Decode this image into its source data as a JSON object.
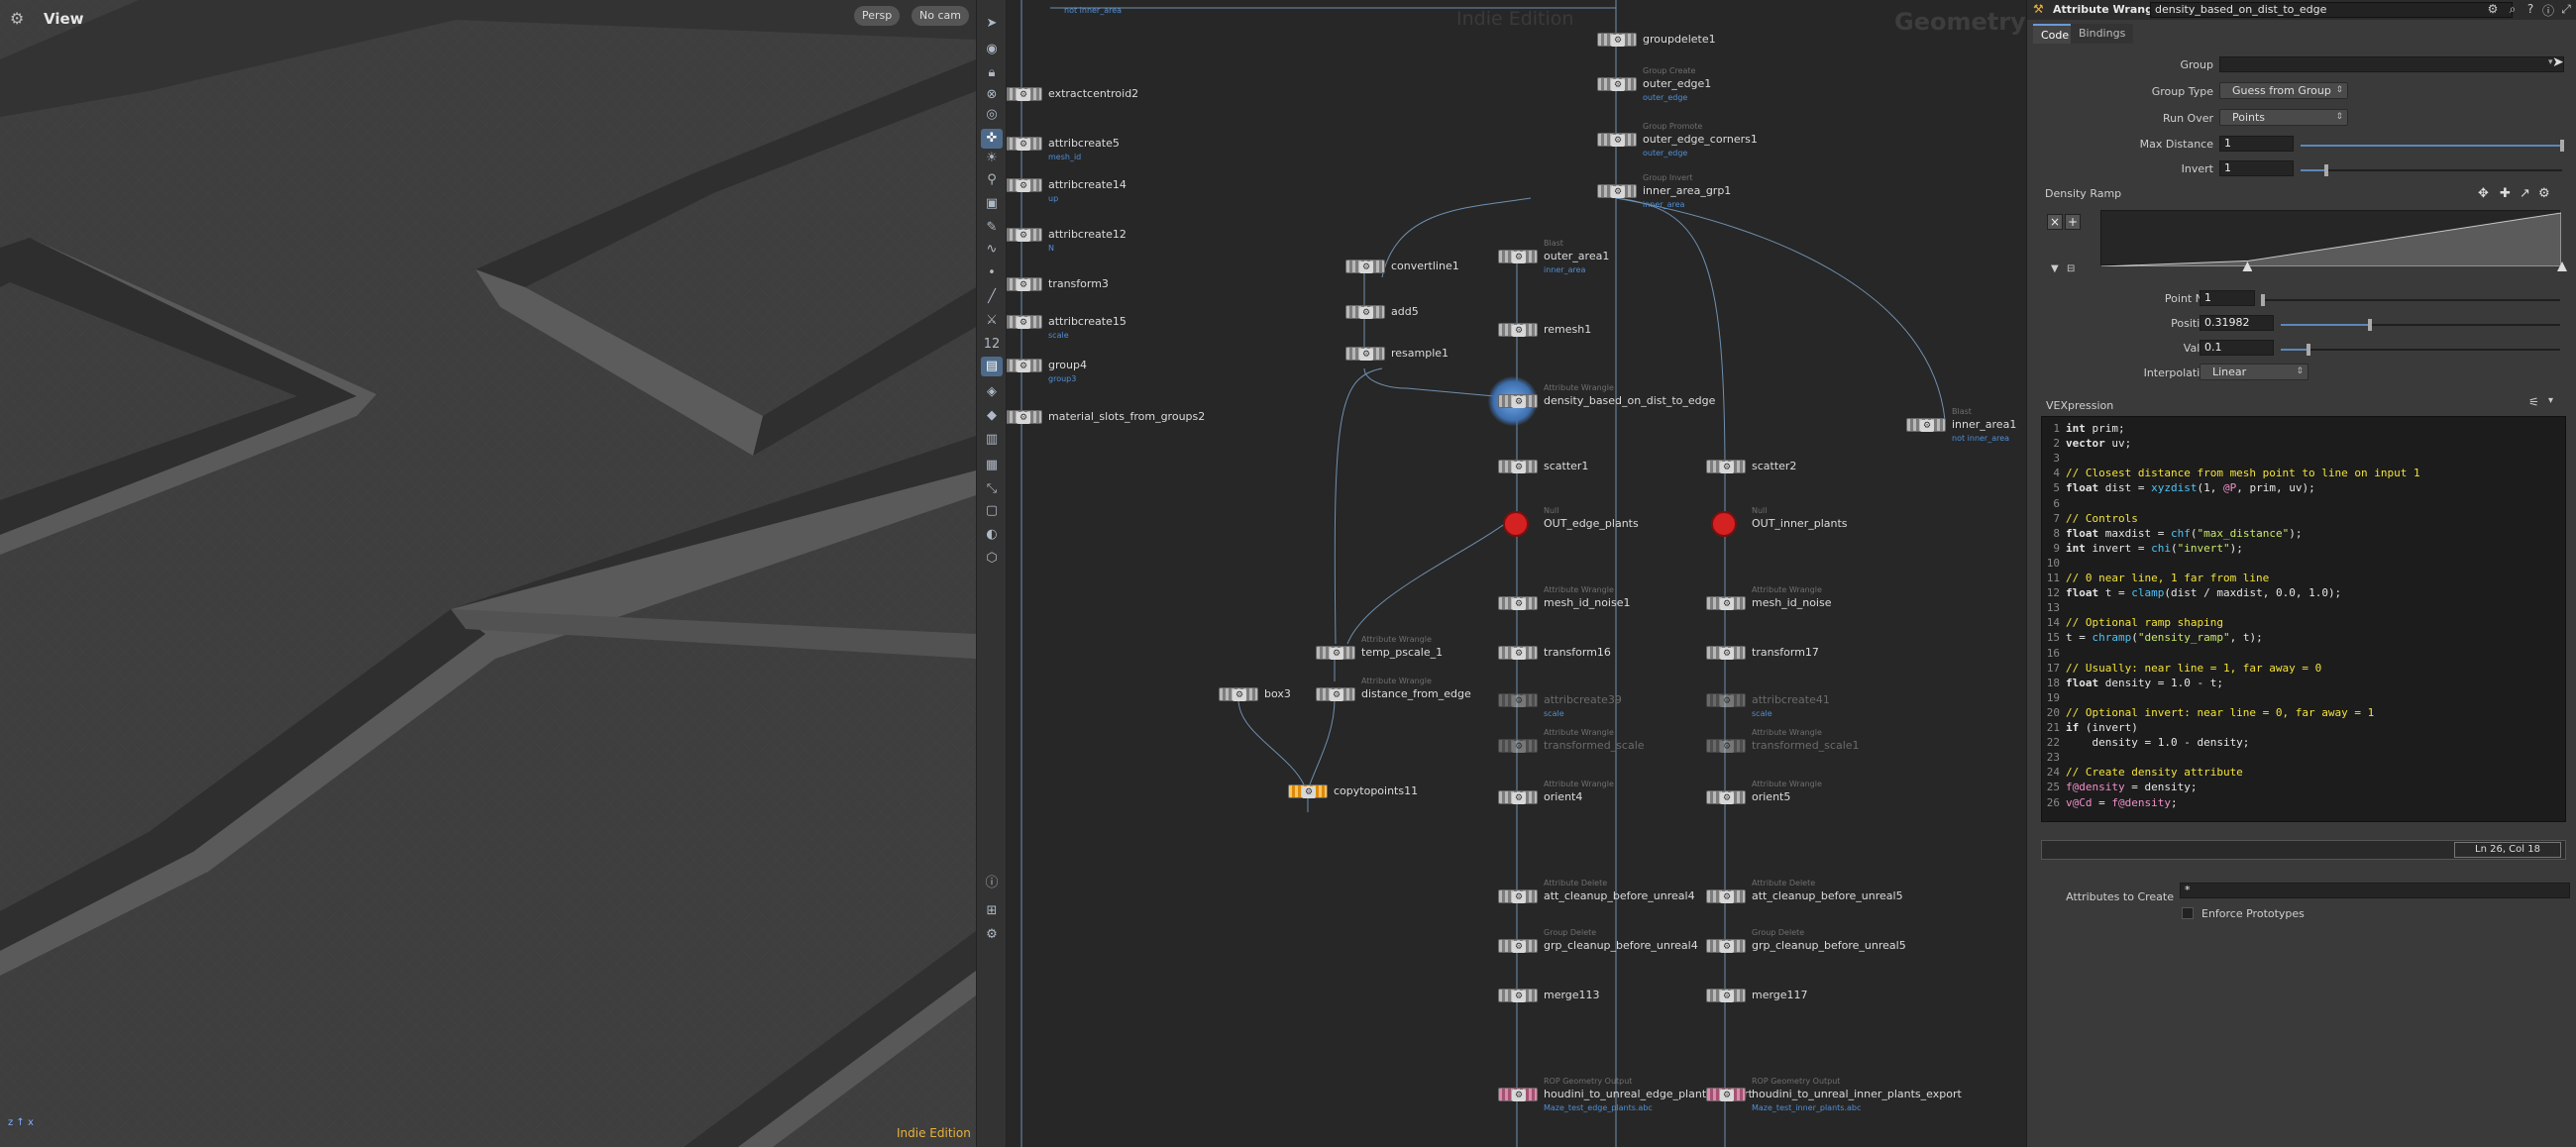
{
  "viewport": {
    "title": "View",
    "perspective": "Persp",
    "camera": "No cam",
    "edition": "Indie Edition",
    "axes": "z ↑ x"
  },
  "toolbar": {
    "icons": [
      "select-icon",
      "view-icon",
      "lock-icon",
      "snap-icon",
      "tumble-icon",
      "pivot-icon",
      "light-icon",
      "handle-icon",
      "geometry-icon",
      "brush-icon",
      "wire-icon",
      "point-icon",
      "edge-icon",
      "knife-icon",
      "number-icon",
      "box-icon",
      "camera-icon",
      "render-icon",
      "layer-icon",
      "grid-icon",
      "path-icon",
      "rect-icon",
      "vis-icon",
      "mesh-icon",
      "info-icon",
      "pane-icon",
      "settings-icon"
    ]
  },
  "network": {
    "edition": "Indie Edition",
    "context": "Geometry",
    "nodes": [
      {
        "name": "extractcentroid2",
        "type": "",
        "comment": ""
      },
      {
        "name": "attribcreate5",
        "type": "",
        "comment": "mesh_id"
      },
      {
        "name": "attribcreate14",
        "type": "",
        "comment": "up"
      },
      {
        "name": "attribcreate12",
        "type": "",
        "comment": "N"
      },
      {
        "name": "transform3",
        "type": "",
        "comment": ""
      },
      {
        "name": "attribcreate15",
        "type": "",
        "comment": "scale"
      },
      {
        "name": "group4",
        "type": "",
        "comment": "group3"
      },
      {
        "name": "material_slots_from_groups2",
        "type": "",
        "comment": ""
      },
      {
        "name": "groupdelete1",
        "type": "",
        "comment": ""
      },
      {
        "name": "outer_edge1",
        "type": "Group Create",
        "comment": "outer_edge"
      },
      {
        "name": "outer_edge_corners1",
        "type": "Group Promote",
        "comment": "outer_edge"
      },
      {
        "name": "inner_area_grp1",
        "type": "Group Invert",
        "comment": "inner_area"
      },
      {
        "name": "convertline1",
        "type": "",
        "comment": ""
      },
      {
        "name": "add5",
        "type": "",
        "comment": ""
      },
      {
        "name": "resample1",
        "type": "",
        "comment": ""
      },
      {
        "name": "outer_area1",
        "type": "Blast",
        "comment": "inner_area"
      },
      {
        "name": "remesh1",
        "type": "",
        "comment": ""
      },
      {
        "name": "density_based_on_dist_to_edge",
        "type": "Attribute Wrangle",
        "comment": ""
      },
      {
        "name": "inner_area1",
        "type": "Blast",
        "comment": "not inner_area"
      },
      {
        "name": "scatter1",
        "type": "",
        "comment": ""
      },
      {
        "name": "scatter2",
        "type": "",
        "comment": ""
      },
      {
        "name": "OUT_edge_plants",
        "type": "Null",
        "comment": ""
      },
      {
        "name": "OUT_inner_plants",
        "type": "Null",
        "comment": ""
      },
      {
        "name": "mesh_id_noise1",
        "type": "Attribute Wrangle",
        "comment": ""
      },
      {
        "name": "mesh_id_noise",
        "type": "Attribute Wrangle",
        "comment": ""
      },
      {
        "name": "temp_pscale_1",
        "type": "Attribute Wrangle",
        "comment": ""
      },
      {
        "name": "distance_from_edge",
        "type": "Attribute Wrangle",
        "comment": ""
      },
      {
        "name": "box3",
        "type": "",
        "comment": ""
      },
      {
        "name": "transform16",
        "type": "",
        "comment": ""
      },
      {
        "name": "transform17",
        "type": "",
        "comment": ""
      },
      {
        "name": "attribcreate39",
        "type": "",
        "comment": "scale"
      },
      {
        "name": "attribcreate41",
        "type": "",
        "comment": "scale"
      },
      {
        "name": "transformed_scale",
        "type": "Attribute Wrangle",
        "comment": ""
      },
      {
        "name": "transformed_scale1",
        "type": "Attribute Wrangle",
        "comment": ""
      },
      {
        "name": "copytopoints11",
        "type": "",
        "comment": ""
      },
      {
        "name": "orient4",
        "type": "Attribute Wrangle",
        "comment": ""
      },
      {
        "name": "orient5",
        "type": "Attribute Wrangle",
        "comment": ""
      },
      {
        "name": "att_cleanup_before_unreal4",
        "type": "Attribute Delete",
        "comment": ""
      },
      {
        "name": "att_cleanup_before_unreal5",
        "type": "Attribute Delete",
        "comment": ""
      },
      {
        "name": "grp_cleanup_before_unreal4",
        "type": "Group Delete",
        "comment": ""
      },
      {
        "name": "grp_cleanup_before_unreal5",
        "type": "Group Delete",
        "comment": ""
      },
      {
        "name": "merge113",
        "type": "",
        "comment": ""
      },
      {
        "name": "merge117",
        "type": "",
        "comment": ""
      },
      {
        "name": "houdini_to_unreal_edge_plants_export",
        "type": "ROP Geometry Output",
        "comment": "Maze_test_edge_plants.abc"
      },
      {
        "name": "houdini_to_unreal_inner_plants_export",
        "type": "ROP Geometry Output",
        "comment": "Maze_test_inner_plants.abc"
      }
    ],
    "top_comment": "not inner_area"
  },
  "params": {
    "node_type": "Attribute Wrangle",
    "node_name": "density_based_on_dist_to_edge",
    "tabs": [
      "Code",
      "Bindings"
    ],
    "group_label": "Group",
    "group_value": "",
    "group_type_label": "Group Type",
    "group_type_value": "Guess from Group",
    "run_over_label": "Run Over",
    "run_over_value": "Points",
    "max_distance_label": "Max Distance",
    "max_distance_value": "1",
    "invert_label": "Invert",
    "invert_value": "1",
    "ramp_label": "Density Ramp",
    "point_no_label": "Point No.",
    "point_no_value": "1",
    "position_label": "Position",
    "position_value": "0.31982",
    "value_label": "Value",
    "value_value": "0.1",
    "interpolation_label": "Interpolation",
    "interpolation_value": "Linear",
    "vex_label": "VEXpression",
    "code": [
      "int prim;",
      "vector uv;",
      "",
      "// Closest distance from mesh point to line on input 1",
      "float dist = xyzdist(1, @P, prim, uv);",
      "",
      "// Controls",
      "float maxdist = chf(\"max_distance\");",
      "int invert = chi(\"invert\");",
      "",
      "// 0 near line, 1 far from line",
      "float t = clamp(dist / maxdist, 0.0, 1.0);",
      "",
      "// Optional ramp shaping",
      "t = chramp(\"density_ramp\", t);",
      "",
      "// Usually: near line = 1, far away = 0",
      "float density = 1.0 - t;",
      "",
      "// Optional invert: near line = 0, far away = 1",
      "if (invert)",
      "    density = 1.0 - density;",
      "",
      "// Create density attribute",
      "f@density = density;",
      "v@Cd = f@density;"
    ],
    "cursor_pos": "Ln 26, Col 18",
    "attribs_label": "Attributes to Create",
    "attribs_value": "*",
    "enforce_label": "Enforce Prototypes",
    "max_distance_fraction": 1.0,
    "invert_fraction": 0.1,
    "position_fraction": 0.31982,
    "value_fraction": 0.1
  }
}
